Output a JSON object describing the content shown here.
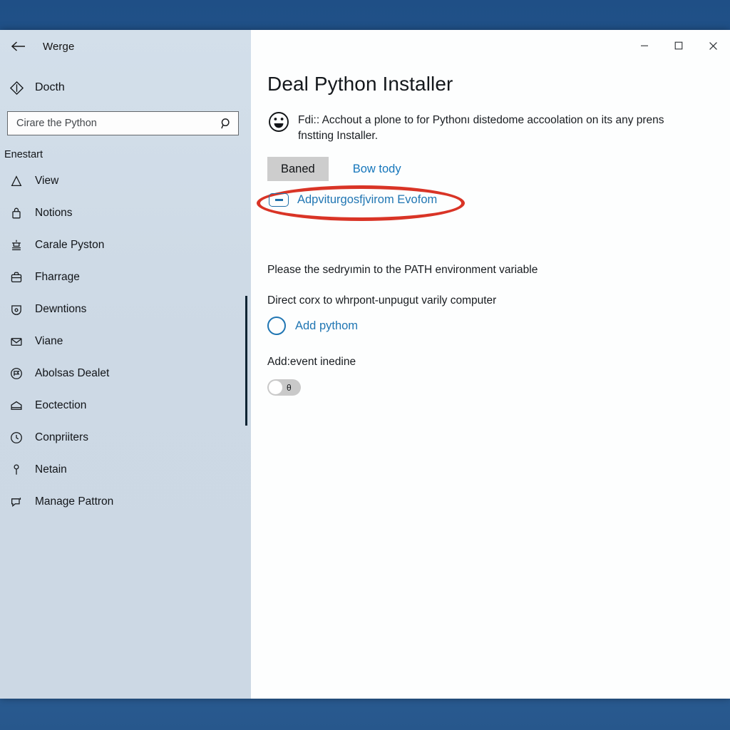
{
  "window": {
    "controls": {
      "minimize": "minimize-icon",
      "maximize": "maximize-icon",
      "close": "close-icon"
    }
  },
  "sidebar": {
    "back_icon": "back-arrow-icon",
    "title": "Werge",
    "account": {
      "icon": "diamond-icon",
      "label": "Docth"
    },
    "search": {
      "value": "",
      "placeholder": "Cirare the Python",
      "icon": "search-icon"
    },
    "section_label": "Enestart",
    "items": [
      {
        "icon": "tent-icon",
        "label": "View"
      },
      {
        "icon": "lock-icon",
        "label": "Notions"
      },
      {
        "icon": "stamp-icon",
        "label": "Carale Pyston"
      },
      {
        "icon": "briefcase-icon",
        "label": "Fharrage"
      },
      {
        "icon": "shield-icon",
        "label": "Dewntions"
      },
      {
        "icon": "mail-icon",
        "label": "Viane"
      },
      {
        "icon": "flag-circle-icon",
        "label": "Abolsas Dealet"
      },
      {
        "icon": "envelope-icon",
        "label": "Eoctection"
      },
      {
        "icon": "clock-icon",
        "label": "Conpriiters"
      },
      {
        "icon": "pin-icon",
        "label": "Netain"
      },
      {
        "icon": "chat-icon",
        "label": "Manage Pattron"
      }
    ]
  },
  "main": {
    "page_title": "Deal Python Installer",
    "notice": {
      "icon": "face-alert-icon",
      "text": "Fdi:: Acchout a plone to for Pythonı distedome accoolation on its any prens fnstting Installer."
    },
    "primary_button": "Baned",
    "secondary_link": "Bow tody",
    "highlighted_option": {
      "checkbox_state": "indeterminate",
      "label": "Adpviturgosfjvirom Evofom",
      "annotation": "red-ellipse"
    },
    "path_line": "Please the sedryımin to the PATH environment variable",
    "direct_line": "Direct corx to whrpont-unpugut varily computer",
    "radio_option": {
      "state": "unchecked",
      "label": "Add pythom"
    },
    "toggle_label": "Add:event inedine",
    "toggle": {
      "state": "off",
      "state_glyph": "θ"
    }
  },
  "colors": {
    "accent_link": "#2076b3",
    "annotation": "#d93426",
    "sidebar_bg": "#cdd9e5",
    "button_bg": "#cdcdcd",
    "desktop": "#2a5d93"
  }
}
